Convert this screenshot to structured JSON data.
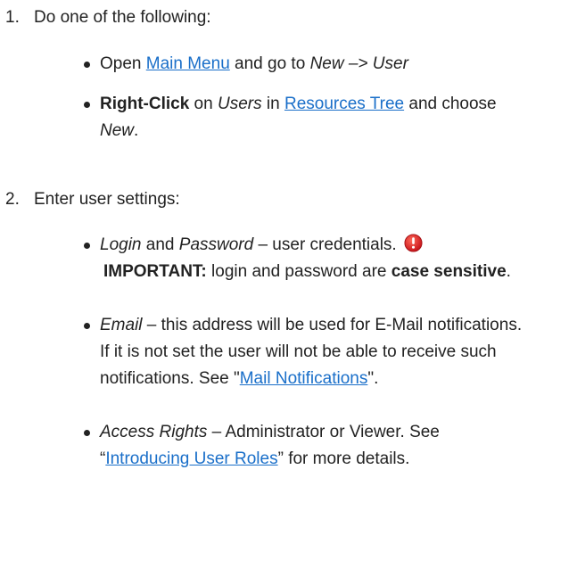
{
  "steps": [
    {
      "number": "1.",
      "title": "Do one of the following:",
      "bullets": {
        "b1": {
          "pre": "Open ",
          "link": "Main Menu",
          "mid": " and go to ",
          "italic": "New –> User"
        },
        "b2": {
          "bold": "Right-Click",
          "mid1": " on ",
          "italic1": "Users",
          "mid2": " in ",
          "link": "Resources Tree",
          "mid3": " and choose ",
          "italic2": "New",
          "end": "."
        }
      }
    },
    {
      "number": "2.",
      "title": "Enter user settings:",
      "bullets": {
        "b1": {
          "italic1": "Login",
          "mid1": " and ",
          "italic2": "Password",
          "mid2": " – user credentials. ",
          "icon": "important-icon",
          "bold1": "IMPORTANT:",
          "mid3": " login and password are ",
          "bold2": "case sensitive",
          "end": "."
        },
        "b2": {
          "italic": "Email",
          "mid": " – this address will be used for E-Mail notifications. If it is not set the user will not be able to receive such notifications. See \"",
          "link": "Mail Notifications",
          "end": "\"."
        },
        "b3": {
          "italic": "Access Rights",
          "mid": " – Administrator or Viewer. See “",
          "link": "Introducing User Roles",
          "end": "” for more details."
        }
      }
    }
  ],
  "colors": {
    "text": "#222222",
    "link": "#1a6fc9",
    "important": "#e02020"
  }
}
